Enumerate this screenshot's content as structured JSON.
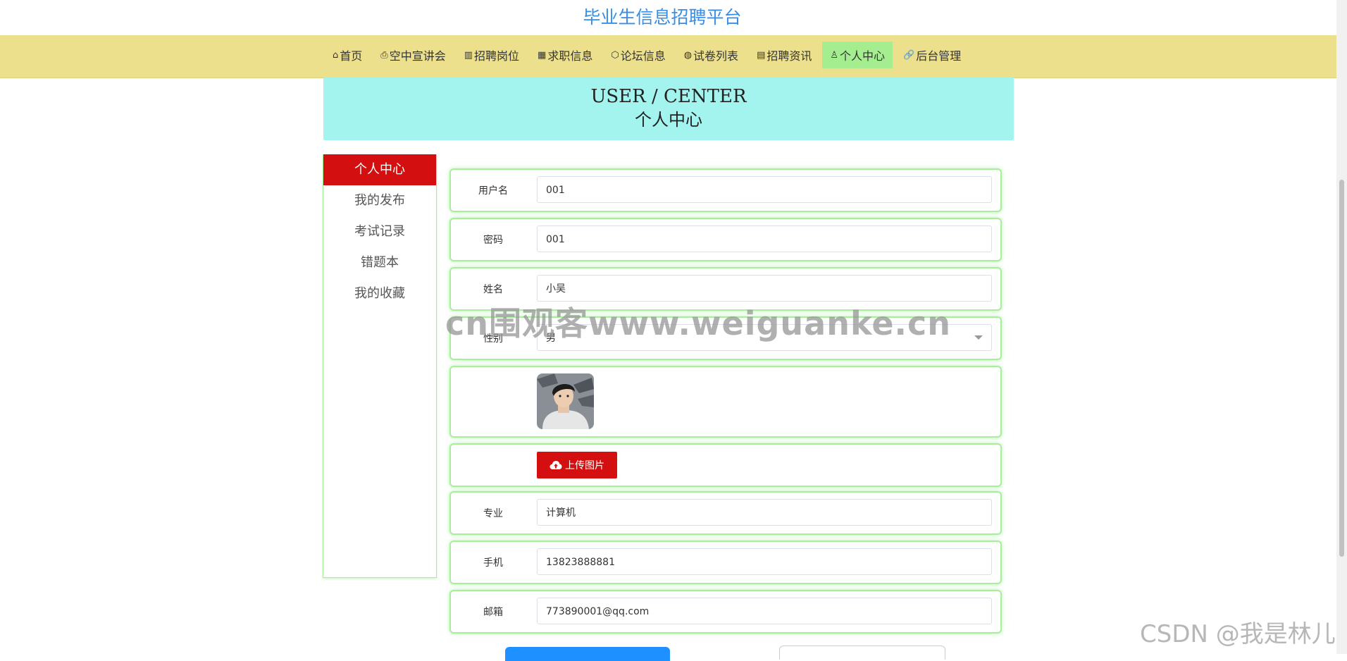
{
  "site": {
    "title": "毕业生信息招聘平台"
  },
  "nav": {
    "items": [
      {
        "icon": "home-icon",
        "glyph": "⌂",
        "label": "首页",
        "active": false
      },
      {
        "icon": "seminar-icon",
        "glyph": "⎙",
        "label": "空中宣讲会",
        "active": false
      },
      {
        "icon": "job-post-icon",
        "glyph": "▥",
        "label": "招聘岗位",
        "active": false
      },
      {
        "icon": "calendar-icon",
        "glyph": "▦",
        "label": "求职信息",
        "active": false
      },
      {
        "icon": "forum-icon",
        "glyph": "⬡",
        "label": "论坛信息",
        "active": false
      },
      {
        "icon": "globe-icon",
        "glyph": "◍",
        "label": "试卷列表",
        "active": false
      },
      {
        "icon": "news-icon",
        "glyph": "▤",
        "label": "招聘资讯",
        "active": false
      },
      {
        "icon": "user-icon",
        "glyph": "♙",
        "label": "个人中心",
        "active": true
      },
      {
        "icon": "link-icon",
        "glyph": "🔗",
        "label": "后台管理",
        "active": false
      }
    ]
  },
  "banner": {
    "en": "USER / CENTER",
    "cn": "个人中心"
  },
  "sidebar": {
    "items": [
      {
        "label": "个人中心",
        "active": true
      },
      {
        "label": "我的发布",
        "active": false
      },
      {
        "label": "考试记录",
        "active": false
      },
      {
        "label": "错题本",
        "active": false
      },
      {
        "label": "我的收藏",
        "active": false
      }
    ]
  },
  "form": {
    "username": {
      "label": "用户名",
      "value": "001"
    },
    "password": {
      "label": "密码",
      "value": "001"
    },
    "name": {
      "label": "姓名",
      "value": "小吴"
    },
    "gender": {
      "label": "性别",
      "value": "男"
    },
    "upload_label": "上传图片",
    "major": {
      "label": "专业",
      "value": "计算机"
    },
    "phone": {
      "label": "手机",
      "value": "13823888881"
    },
    "email": {
      "label": "邮箱",
      "value": "773890001@qq.com"
    }
  },
  "watermark": "cn围观客www.weiguanke.cn",
  "csdn_watermark": "CSDN @我是林儿",
  "colors": {
    "nav_bg": "#ede08d",
    "nav_active": "#a4ee90",
    "banner_bg": "#a3f4ef",
    "accent_red": "#d30f0f",
    "row_border": "#a6f09a",
    "title_blue": "#3a8ee6",
    "primary_blue": "#1e90ff"
  }
}
